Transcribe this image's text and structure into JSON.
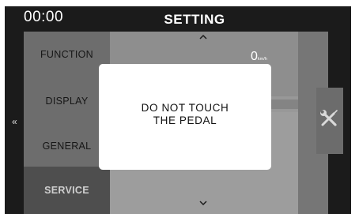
{
  "header": {
    "clock": "00:00",
    "title": "SETTING"
  },
  "menu": {
    "items": [
      {
        "label": "FUNCTION",
        "active": false
      },
      {
        "label": "DISPLAY",
        "active": false
      },
      {
        "label": "GENERAL",
        "active": false
      },
      {
        "label": "SERVICE",
        "active": true
      }
    ]
  },
  "content": {
    "speed_value": "0",
    "speed_unit": "km/h",
    "scroll_up_icon": "chevron-up",
    "scroll_down_icon": "chevron-down",
    "next_icon": "chevron-right"
  },
  "navigation": {
    "back_label": "«",
    "tools_icon": "wrench-screwdriver"
  },
  "modal": {
    "message": "DO NOT TOUCH\nTHE PEDAL"
  },
  "colors": {
    "background": "#1b1b1b",
    "menu": "#6d6d6d",
    "menu_active": "#4e4e4e",
    "content": "#989898",
    "modal": "#ffffff"
  }
}
